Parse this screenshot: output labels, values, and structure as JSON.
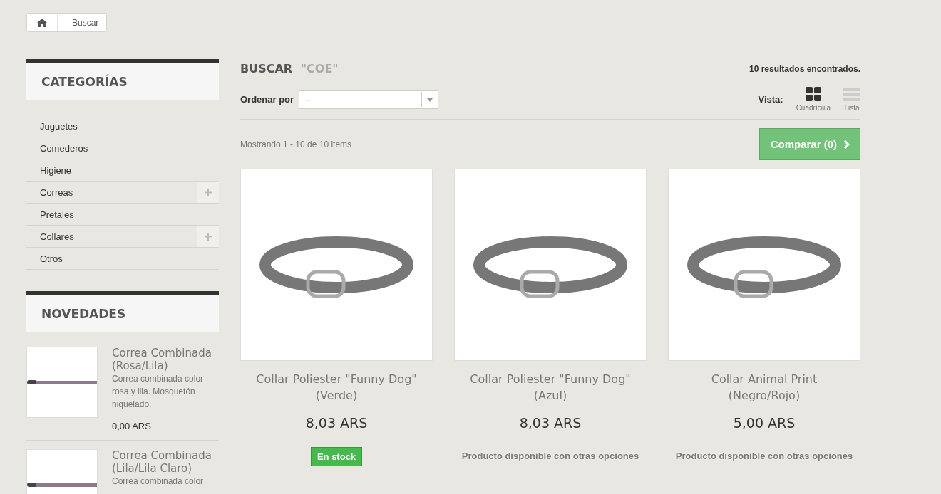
{
  "breadcrumb": {
    "current": "Buscar"
  },
  "categories": {
    "title": "CATEGORÍAS",
    "items": [
      {
        "label": "Juguetes",
        "expandable": false
      },
      {
        "label": "Comederos",
        "expandable": false
      },
      {
        "label": "Higiene",
        "expandable": false
      },
      {
        "label": "Correas",
        "expandable": true
      },
      {
        "label": "Pretales",
        "expandable": false
      },
      {
        "label": "Collares",
        "expandable": true
      },
      {
        "label": "Otros",
        "expandable": false
      }
    ]
  },
  "new_products": {
    "title": "NOVEDADES",
    "items": [
      {
        "name": "Correa Combinada (Rosa/Lila)",
        "description": "Correa combinada color rosa y lila. Mosquetón niquelado.",
        "price": "0,00 ARS"
      },
      {
        "name": "Correa Combinada (Lila/Lila Claro)",
        "description": "Correa combinada color"
      }
    ]
  },
  "search": {
    "heading": "BUSCAR",
    "query": "\"COE\"",
    "results": "10 resultados encontrados."
  },
  "sort": {
    "label": "Ordenar por",
    "value": "--"
  },
  "view": {
    "label": "Vista:",
    "options": [
      {
        "label": "Cuadrícula",
        "kind": "grid",
        "selected": true
      },
      {
        "label": "Lista",
        "kind": "list",
        "selected": false
      }
    ]
  },
  "showing": "Mostrando 1 - 10 de 10 items",
  "compare_button": "Comparar (0)",
  "products": [
    {
      "name": "Collar Poliester \"Funny Dog\" (Verde)",
      "price": "8,03 ARS",
      "availability": {
        "kind": "badge",
        "text": "En stock"
      }
    },
    {
      "name": "Collar Poliester \"Funny Dog\" (Azul)",
      "price": "8,03 ARS",
      "availability": {
        "kind": "note",
        "text": "Producto disponible con otras opciones"
      }
    },
    {
      "name": "Collar Animal Print (Negro/Rojo)",
      "price": "5,00 ARS",
      "availability": {
        "kind": "note",
        "text": "Producto disponible con otras opciones"
      }
    }
  ]
}
